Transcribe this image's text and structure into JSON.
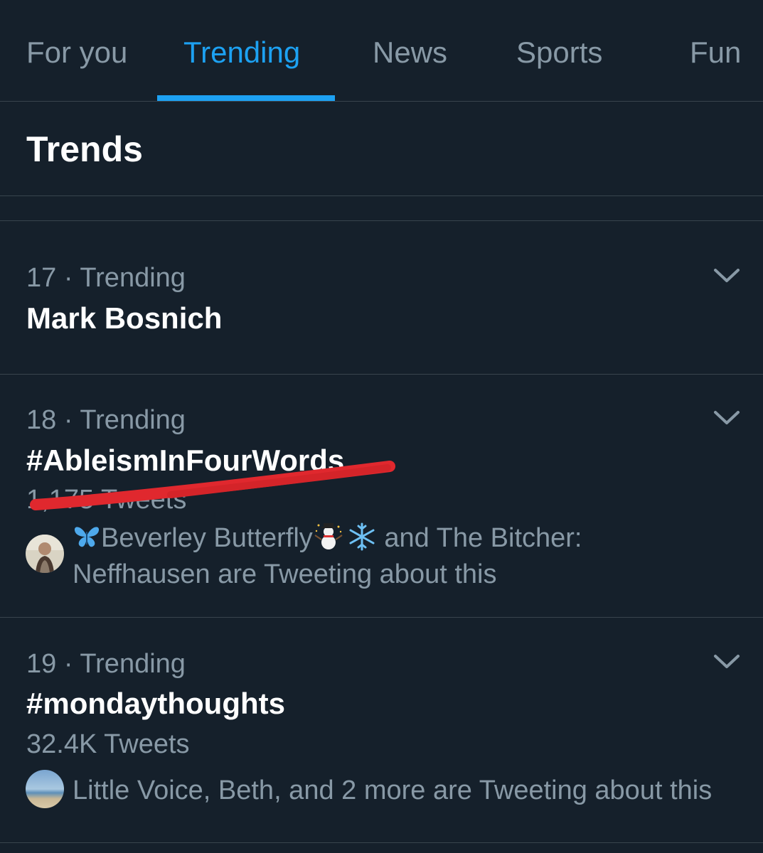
{
  "tabs": [
    {
      "label": "For you",
      "active": false
    },
    {
      "label": "Trending",
      "active": true
    },
    {
      "label": "News",
      "active": false
    },
    {
      "label": "Sports",
      "active": false
    },
    {
      "label": "Fun",
      "active": false
    }
  ],
  "section_title": "Trends",
  "trends": [
    {
      "meta": "17 · Trending",
      "name": "Mark Bosnich"
    },
    {
      "meta": "18 · Trending",
      "name": "#AbleismInFourWords",
      "count": "1,175 Tweets",
      "social_line1_prefix": "Beverley Butterfly",
      "social_line1_suffix": " and The Bitcher:",
      "social_line2": "Neffhausen are Tweeting about this"
    },
    {
      "meta": "19 · Trending",
      "name": "#mondaythoughts",
      "count": "32.4K Tweets",
      "social_line1": "Little Voice, Beth, and 2 more are Tweeting about this"
    }
  ],
  "colors": {
    "background": "#15202b",
    "accent": "#1da1f2",
    "secondary_text": "#8899a6",
    "divider": "#38444d",
    "annotation": "#e0282e"
  },
  "icons": {
    "chevron": "chevron-down-icon",
    "butterfly": "butterfly-icon",
    "snowman": "snowman-icon",
    "snowflake": "snowflake-icon"
  }
}
